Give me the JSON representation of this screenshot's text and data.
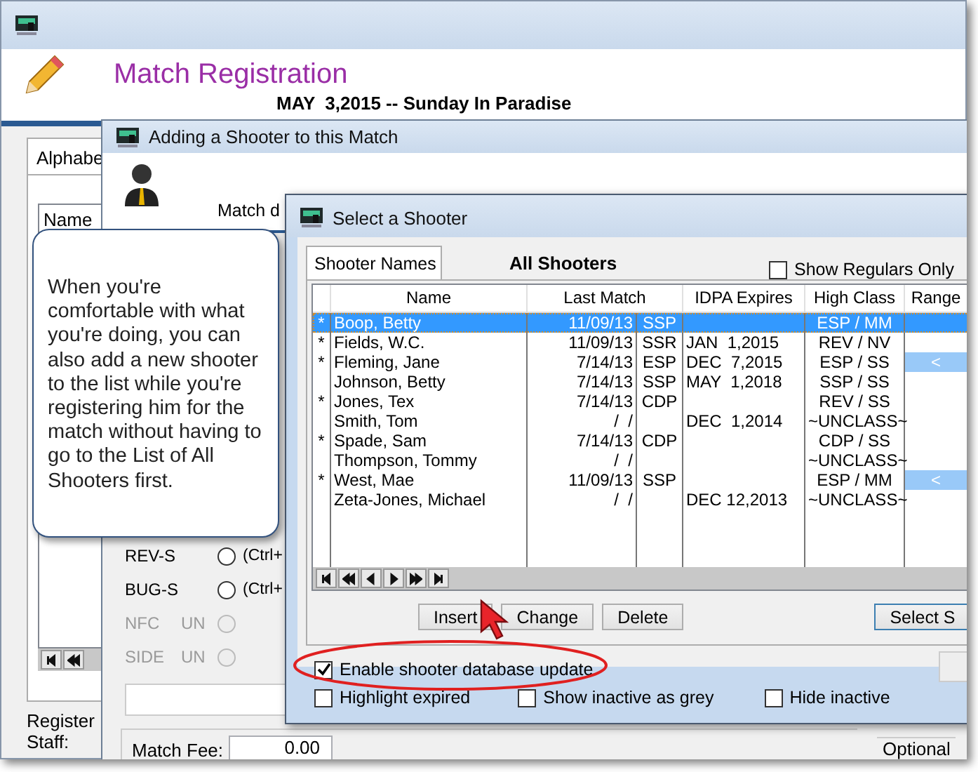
{
  "main_window": {
    "title": "Match Registration",
    "subtitle": "MAY  3,2015 -- Sunday In Paradise",
    "tab": "Alphabe",
    "list_header": "Name",
    "register_label": "Register",
    "staff_label": "Staff:"
  },
  "adding_window": {
    "title": "Adding a Shooter to this Match",
    "match_label": "Match d",
    "divisions": [
      {
        "name": "REV-S",
        "shortcut": "(Ctrl+",
        "selected": false,
        "disabled": false
      },
      {
        "name": "BUG-S",
        "shortcut": "(Ctrl+",
        "selected": false,
        "disabled": false
      },
      {
        "name": "NFC",
        "class": "UN",
        "selected": false,
        "disabled": true
      },
      {
        "name": "SIDE",
        "class": "UN",
        "selected": false,
        "disabled": true
      }
    ],
    "match_fee": {
      "label": "Match Fee:",
      "value": "0.00"
    },
    "optional_label": "Optional"
  },
  "select_window": {
    "title": "Select a Shooter",
    "tab": "Shooter Names",
    "heading": "All Shooters",
    "show_regulars": {
      "label": "Show Regulars Only",
      "checked": false
    },
    "columns": [
      "Name",
      "Last Match",
      "IDPA Expires",
      "High Class",
      "Range"
    ],
    "rows": [
      {
        "flag": "*",
        "name": "Boop, Betty",
        "last_match": "11/09/13",
        "division": "SSP",
        "high_class": "ESP / MM",
        "selected": true
      },
      {
        "flag": "*",
        "name": "Fields, W.C.",
        "last_match": "11/09/13",
        "division": "SSR",
        "idpa_expires": "JAN  1,2015",
        "high_class": "REV / NV",
        "selected": false
      },
      {
        "flag": "*",
        "name": "Fleming, Jane",
        "last_match": "7/14/13",
        "division": "ESP",
        "idpa_expires": "DEC  7,2015",
        "high_class": "ESP / SS",
        "range": "<",
        "selected": false
      },
      {
        "name": "Johnson, Betty",
        "last_match": "7/14/13",
        "division": "SSP",
        "idpa_expires": "MAY  1,2018",
        "high_class": "SSP / SS",
        "selected": false
      },
      {
        "flag": "*",
        "name": "Jones, Tex",
        "last_match": "7/14/13",
        "division": "CDP",
        "high_class": "REV / SS",
        "selected": false
      },
      {
        "name": "Smith, Tom",
        "last_match": "/  /",
        "idpa_expires": "DEC  1,2014",
        "high_class": "~UNCLASS~",
        "selected": false
      },
      {
        "flag": "*",
        "name": "Spade, Sam",
        "last_match": "7/14/13",
        "division": "CDP",
        "high_class": "CDP / SS",
        "selected": false
      },
      {
        "name": "Thompson, Tommy",
        "last_match": "/  /",
        "high_class": "~UNCLASS~",
        "selected": false
      },
      {
        "flag": "*",
        "name": "West, Mae",
        "last_match": "11/09/13",
        "division": "SSP",
        "high_class": "ESP / MM",
        "range": "<",
        "selected": false
      },
      {
        "name": "Zeta-Jones, Michael",
        "last_match": "/  /",
        "idpa_expires": "DEC 12,2013",
        "high_class": "~UNCLASS~",
        "selected": false
      }
    ],
    "buttons": [
      {
        "label": "Insert"
      },
      {
        "label": "Change"
      },
      {
        "label": "Delete"
      },
      {
        "label": "Select S"
      }
    ],
    "options": [
      {
        "label": "Enable shooter database update",
        "checked": true
      },
      {
        "label": "Highlight expired",
        "checked": false
      },
      {
        "label": "Show inactive as grey",
        "checked": false
      },
      {
        "label": "Hide inactive",
        "checked": false
      }
    ]
  },
  "callout": {
    "text": "When you're comfortable with what you're doing, you can also add a new shooter to the list while you're registering him for the match without having to go to the List of All Shooters first."
  }
}
